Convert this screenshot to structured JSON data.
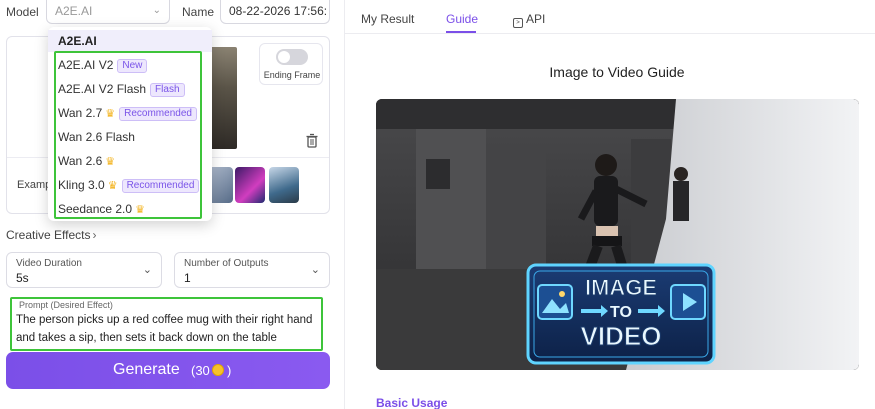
{
  "form": {
    "model_label": "Model",
    "model_value": "A2E.AI",
    "name_label": "Name",
    "name_value": "08-22-2026 17:56:",
    "ending_frame_label": "Ending Frame",
    "examples_label": "Examp"
  },
  "dropdown": {
    "header": "A2E.AI",
    "items": [
      {
        "label": "A2E.AI V2",
        "tag": "New",
        "crown": false
      },
      {
        "label": "A2E.AI V2 Flash",
        "tag": "Flash",
        "crown": false
      },
      {
        "label": "Wan 2.7",
        "tag": "Recommended",
        "crown": true
      },
      {
        "label": "Wan 2.6 Flash",
        "tag": "",
        "crown": false
      },
      {
        "label": "Wan 2.6",
        "tag": "",
        "crown": true
      },
      {
        "label": "Kling 3.0",
        "tag": "Recommended",
        "crown": true
      },
      {
        "label": "Seedance 2.0",
        "tag": "",
        "crown": true
      }
    ]
  },
  "creative_effects": "Creative Effects",
  "video_duration": {
    "label": "Video Duration",
    "value": "5s"
  },
  "outputs": {
    "label": "Number of Outputs",
    "value": "1"
  },
  "prompt": {
    "label": "Prompt (Desired Effect)",
    "text": "The person picks up a red coffee mug with their right hand and takes a sip, then sets it back down on the table"
  },
  "generate": {
    "label": "Generate",
    "cost_prefix": "(30",
    "cost_suffix": ")"
  },
  "tabs": {
    "my_result": "My Result",
    "guide": "Guide",
    "api": "API"
  },
  "guide": {
    "title": "Image to Video Guide",
    "badge_line1": "IMAGE",
    "badge_line2": "TO",
    "badge_line3": "VIDEO",
    "basic_usage": "Basic Usage"
  },
  "colors": {
    "accent": "#7b4fe8",
    "highlight": "#3ec43a",
    "crown": "#f3b21a"
  }
}
